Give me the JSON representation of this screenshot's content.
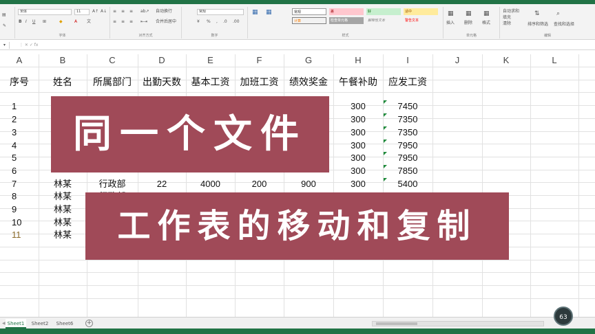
{
  "ribbon": {
    "font_name": "宋体",
    "font_size": "11",
    "number_format": "常规",
    "styles": {
      "normal": "常规",
      "bad": "差",
      "good": "好",
      "neutral": "适中",
      "calculation": "计算",
      "check_cell": "检查单元格",
      "explanatory": "解释性文本",
      "warning": "警告文本"
    },
    "group_labels": {
      "clipboard": "剪贴板",
      "font": "字体",
      "alignment": "对齐方式",
      "number": "数字",
      "styles": "样式",
      "cells": "单元格",
      "editing": "编辑"
    },
    "alignment": {
      "wrap": "自动换行",
      "merge": "合并后居中"
    },
    "cells": {
      "insert": "插入",
      "delete": "删除",
      "format": "格式"
    },
    "editing": {
      "autosum": "自动求和",
      "fill": "填充",
      "clear": "清除",
      "sort": "排序和筛选",
      "find": "查找和选择"
    }
  },
  "formula_bar": {
    "name_box": "▾",
    "icons": "⋮  ✕  ✓  fx"
  },
  "columns": [
    "A",
    "B",
    "C",
    "D",
    "E",
    "F",
    "G",
    "H",
    "I",
    "J",
    "K",
    "L"
  ],
  "table": {
    "headers": [
      "序号",
      "姓名",
      "所属部门",
      "出勤天数",
      "基本工资",
      "加班工资",
      "绩效奖金",
      "午餐补助",
      "应发工资"
    ],
    "seq": [
      "1",
      "2",
      "3",
      "4",
      "5",
      "6",
      "7",
      "8",
      "9",
      "10",
      "11"
    ],
    "names_visible": [
      "林某",
      "林某",
      "林某",
      "林某",
      "林某"
    ],
    "row7": {
      "dept": "行政部",
      "days": "22",
      "base": "4000",
      "overtime": "200",
      "bonus": "900"
    },
    "row8_dept_partial": "行政部",
    "lunch": [
      "300",
      "300",
      "300",
      "300",
      "300",
      "300",
      "300"
    ],
    "pay": [
      "7450",
      "7350",
      "7350",
      "7950",
      "7950",
      "7850",
      "5400"
    ]
  },
  "banners": {
    "title1": "同一个文件",
    "title2": "工作表的移动和复制"
  },
  "sheets": [
    "Sheet1",
    "Sheet2",
    "Sheet6"
  ],
  "add_sheet": "+",
  "badge": "63"
}
